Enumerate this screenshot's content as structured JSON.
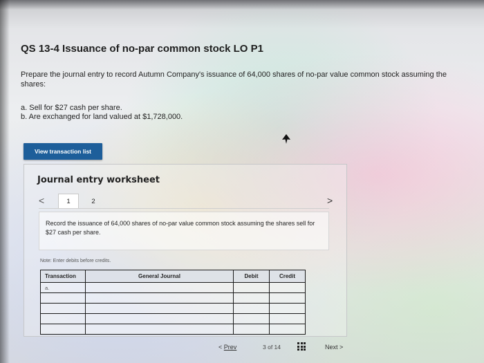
{
  "problem": {
    "title": "QS 13-4 Issuance of no-par common stock LO P1",
    "intro": "Prepare the journal entry to record Autumn Company's issuance of 64,000 shares of no-par value common stock assuming the shares:",
    "part_a": "a. Sell for $27 cash per share.",
    "part_b": "b. Are exchanged for land valued at $1,728,000."
  },
  "buttons": {
    "view_transaction_list": "View transaction list"
  },
  "worksheet": {
    "title": "Journal entry worksheet",
    "tabs": [
      "1",
      "2"
    ],
    "prev_glyph": "<",
    "next_glyph": ">",
    "instruction": "Record the issuance of 64,000 shares of no-par value common stock assuming the shares sell for $27 cash per share.",
    "note": "Note: Enter debits before credits.",
    "headers": {
      "transaction": "Transaction",
      "general_journal": "General Journal",
      "debit": "Debit",
      "credit": "Credit"
    },
    "rows": [
      {
        "transaction": "a."
      },
      {
        "transaction": ""
      },
      {
        "transaction": ""
      },
      {
        "transaction": ""
      },
      {
        "transaction": ""
      }
    ]
  },
  "pagination": {
    "prev_arrow": "<",
    "prev_label": "Prev",
    "count": "3 of 14",
    "next_label": "Next",
    "next_arrow": ">"
  },
  "colors": {
    "button_bg": "#1d5e9a",
    "table_header_bg": "#dce0e8"
  }
}
